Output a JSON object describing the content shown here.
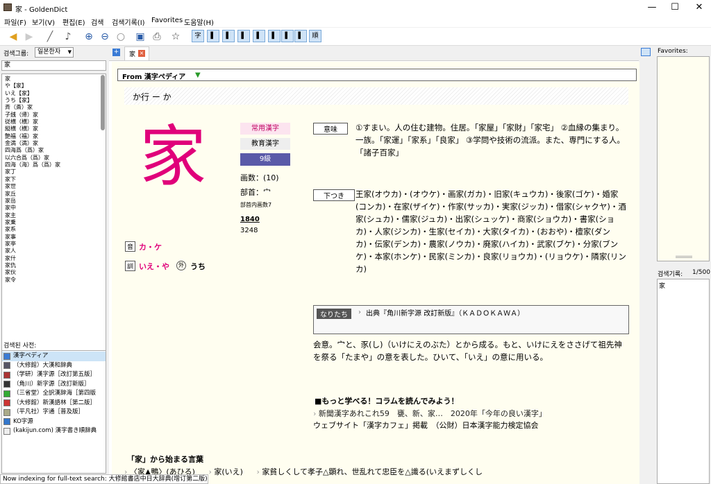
{
  "window": {
    "title": "家 - GoldenDict"
  },
  "menu": [
    "파일(F)",
    "보기(V)",
    "편집(E)",
    "검색",
    "검색기록(I)",
    "Favorites",
    "도움말(H)"
  ],
  "toolbar": {
    "dict_icons": [
      "字",
      "▌",
      "▌",
      "▌",
      "▌",
      "▌",
      "▌",
      "▌",
      "順"
    ]
  },
  "search": {
    "group_label": "검색그룹:",
    "group_value": "일본한자",
    "query": "家"
  },
  "word_list": [
    "家",
    "や【家】",
    "いえ【家】",
    "うち【家】",
    "斉（斎）家",
    "子銭（帰）家",
    "従横（横）家",
    "縦横（横）家",
    "艶福（福）家",
    "金満（満）家",
    "四海爲（爲）家",
    "以六合爲（爲）家",
    "四海（海）爲（爲）家",
    "家丁",
    "家下",
    "家世",
    "家丘",
    "家岳",
    "家中",
    "家主",
    "家乗",
    "家系",
    "家事",
    "家亭",
    "家人",
    "家什",
    "家仇",
    "家伙",
    "家令"
  ],
  "found_dicts": {
    "label": "검색된 사전:",
    "items": [
      "漢字ペディア",
      "（大修館）大漢和辞典",
      "（学研）漢字源［改訂第五版］",
      "（角川）新字源［改訂新版］",
      "（三省堂）全訳漢辞海［第四版",
      "（大修館）新漢語林［第二版］",
      "（平凡社）字通［普及版］",
      "KO字源",
      "(kakijun.com) 漢字書き順辞典"
    ]
  },
  "tab": {
    "label": "家"
  },
  "article": {
    "from_label": "From 漢字ペディア",
    "reading_header": "か行 ー か",
    "kanji": "家",
    "badges": [
      "常用漢字",
      "教育漢字",
      "9級"
    ],
    "strokes": "画数：(10)",
    "radical": "部首：宀",
    "radical_inner": "部首内画数7",
    "code1": "1840",
    "code2": "3248",
    "on_label": "音",
    "on_reading": "カ・ケ",
    "kun_label": "訓",
    "kun_reading": "いえ・や",
    "gai_label": "外",
    "gai_reading": "うち",
    "meaning_label": "意味",
    "meaning_text": "①すまい。人の住む建物。住居。「家屋」「家財」「家宅」 ②血縁の集まり。一族。「家運」「家系」「良家」 ③学問や技術の流派。また、専門にする人。「諸子百家」",
    "shitatsuki_label": "下つき",
    "shitatsuki_text": "王家(オウカ)・(オウケ)・画家(ガカ)・旧家(キュウカ)・後家(ゴケ)・婚家(コンカ)・在家(ザイケ)・作家(サッカ)・実家(ジッカ)・借家(シャクヤ)・酒家(シュカ)・儒家(ジュカ)・出家(シュッケ)・商家(ショウカ)・書家(ショカ)・人家(ジンカ)・生家(セイカ)・大家(タイカ)・(おおや)・檀家(ダンカ)・伝家(デンカ)・農家(ノウカ)・廃家(ハイカ)・武家(ブケ)・分家(ブンケ)・本家(ホンケ)・民家(ミンカ)・良家(リョウカ)・(リョウケ)・隣家(リンカ)",
    "naritachi_label": "なりたち",
    "naritachi_source": "出典『角川新字源 改訂新版』（ＫＡＤＯＫＡＷＡ）",
    "naritachi_text": "会意。宀と、豕(し)（いけにえのぶた）とから成る。もと、いけにえをささげて祖先神を祭る「たまや」の意を表した。ひいて、「いえ」の意に用いる。",
    "column_title": "■もっと学べる！コラムを読んでみよう！",
    "column_line1": "新聞漢字あれこれ59　甕、新、家…　2020年「今年の良い漢字」",
    "column_line2": "ウェブサイト「漢字カフェ」掲載　（公財）日本漢字能力検定協会",
    "phrases_title": "「家」から始まる言葉",
    "phrases": [
      "〈家▲鴨〉(あひる)",
      "家(いえ)",
      "家貧しくして孝子△顕れ、世乱れて忠臣を△識る(いえまずしくし"
    ]
  },
  "favorites": {
    "label": "Favorites:"
  },
  "history": {
    "label": "검색기록:",
    "count": "1/500",
    "items": [
      "家"
    ]
  },
  "status": {
    "text": "Now indexing for full-text search: 大修館書店中日大辞典(增订第二版)"
  }
}
